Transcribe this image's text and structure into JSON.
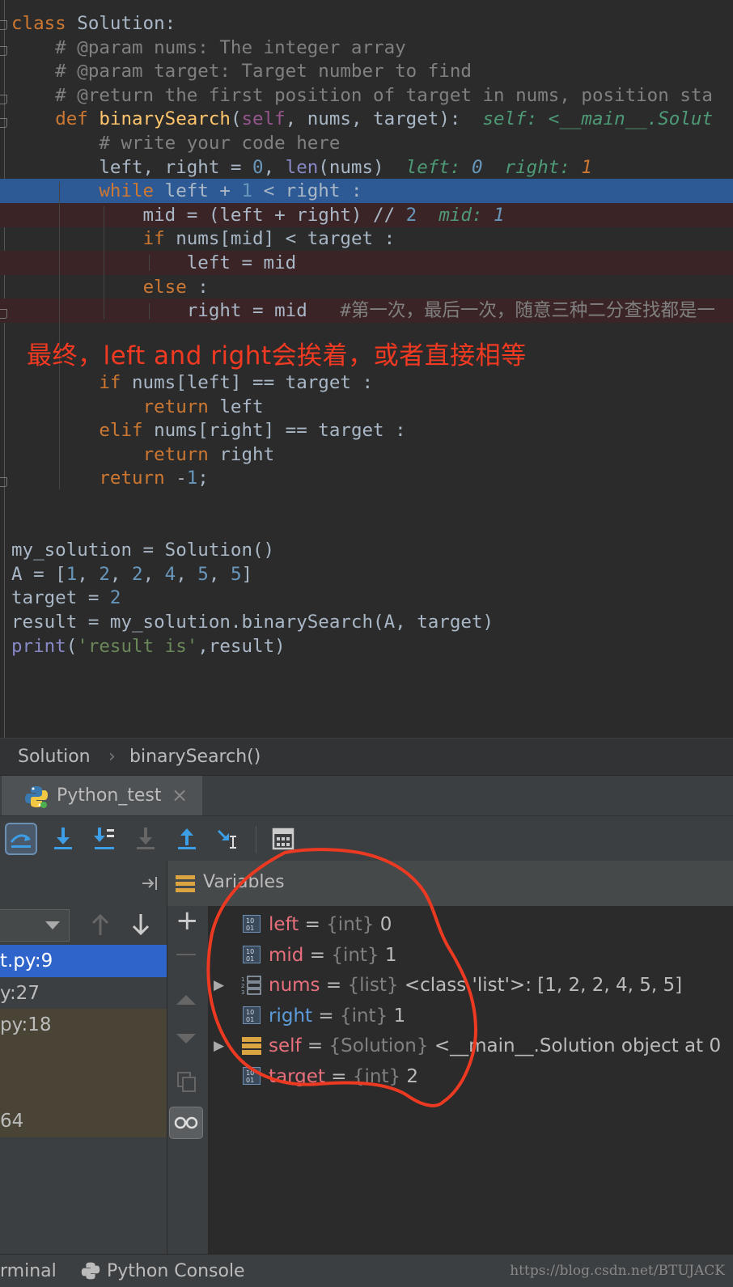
{
  "editor": {
    "lines": [
      [
        {
          "t": "class",
          "c": "kw"
        },
        {
          "t": " Solution:"
        }
      ],
      [
        {
          "t": "    # @param nums: The integer array",
          "c": "cm"
        }
      ],
      [
        {
          "t": "    # @param target: Target number to find",
          "c": "cm"
        }
      ],
      [
        {
          "t": "    # @return the first position of target in nums, position sta",
          "c": "cm"
        }
      ],
      [
        {
          "t": "    "
        },
        {
          "t": "def",
          "c": "kw"
        },
        {
          "t": " "
        },
        {
          "t": "binarySearch",
          "c": "fn"
        },
        {
          "t": "("
        },
        {
          "t": "self",
          "c": "sf"
        },
        {
          "t": ", nums, target):  "
        },
        {
          "t": "self: <__main__.Solut",
          "c": "hint"
        }
      ],
      [
        {
          "t": "        # write your code here",
          "c": "cm"
        }
      ],
      [
        {
          "t": "        left, right = "
        },
        {
          "t": "0",
          "c": "num"
        },
        {
          "t": ", "
        },
        {
          "t": "len",
          "c": "bi"
        },
        {
          "t": "(nums)  "
        },
        {
          "t": "left: ",
          "c": "hint"
        },
        {
          "t": "0",
          "c": "hintn"
        },
        {
          "t": "  right: ",
          "c": "hint"
        },
        {
          "t": "1",
          "c": "hintv"
        }
      ],
      [
        {
          "t": "        "
        },
        {
          "t": "while",
          "c": "kw"
        },
        {
          "t": " left + "
        },
        {
          "t": "1",
          "c": "num"
        },
        {
          "t": " < right :"
        }
      ],
      [
        {
          "t": "            mid = (left + right) // "
        },
        {
          "t": "2",
          "c": "num"
        },
        {
          "t": "  "
        },
        {
          "t": "mid: ",
          "c": "hint"
        },
        {
          "t": "1",
          "c": "hintn"
        }
      ],
      [
        {
          "t": "            "
        },
        {
          "t": "if",
          "c": "kw"
        },
        {
          "t": " nums[mid] < target :"
        }
      ],
      [
        {
          "t": "                left = mid"
        }
      ],
      [
        {
          "t": "            "
        },
        {
          "t": "else",
          "c": "kw"
        },
        {
          "t": " :"
        }
      ],
      [
        {
          "t": "                right = mid   "
        },
        {
          "t": "#第一次，最后一次，随意三种二分查找都是一",
          "c": "cm"
        }
      ],
      [
        {
          "t": ""
        }
      ],
      [
        {
          "t": ""
        }
      ],
      [
        {
          "t": "        "
        },
        {
          "t": "if",
          "c": "kw"
        },
        {
          "t": " nums[left] == target :"
        }
      ],
      [
        {
          "t": "            "
        },
        {
          "t": "return",
          "c": "kw"
        },
        {
          "t": " left"
        }
      ],
      [
        {
          "t": "        "
        },
        {
          "t": "elif",
          "c": "kw"
        },
        {
          "t": " nums[right] == target :"
        }
      ],
      [
        {
          "t": "            "
        },
        {
          "t": "return",
          "c": "kw"
        },
        {
          "t": " right"
        }
      ],
      [
        {
          "t": "        "
        },
        {
          "t": "return",
          "c": "kw"
        },
        {
          "t": " -"
        },
        {
          "t": "1",
          "c": "num"
        },
        {
          "t": ";"
        }
      ],
      [
        {
          "t": ""
        }
      ],
      [
        {
          "t": ""
        }
      ],
      [
        {
          "t": "my_solution = Solution()"
        }
      ],
      [
        {
          "t": "A = ["
        },
        {
          "t": "1",
          "c": "num"
        },
        {
          "t": ", "
        },
        {
          "t": "2",
          "c": "num"
        },
        {
          "t": ", "
        },
        {
          "t": "2",
          "c": "num"
        },
        {
          "t": ", "
        },
        {
          "t": "4",
          "c": "num"
        },
        {
          "t": ", "
        },
        {
          "t": "5",
          "c": "num"
        },
        {
          "t": ", "
        },
        {
          "t": "5",
          "c": "num"
        },
        {
          "t": "]"
        }
      ],
      [
        {
          "t": "target = "
        },
        {
          "t": "2",
          "c": "num"
        }
      ],
      [
        {
          "t": "result = my_solution.binarySearch(A, target)"
        }
      ],
      [
        {
          "t": "print",
          "c": "bi"
        },
        {
          "t": "("
        },
        {
          "t": "'result is'",
          "c": "st"
        },
        {
          "t": ",result)"
        }
      ]
    ],
    "exec_line": 7,
    "breakpoint_lines": [
      8,
      10,
      12
    ],
    "annotation": "最终，left and right会挨着，或者直接相等"
  },
  "breadcrumb": {
    "class_name": "Solution",
    "separator": "›",
    "method_name": "binarySearch()"
  },
  "debug": {
    "tab_label": "Python_test",
    "tab_close": "×",
    "variables_title": "Variables",
    "frames": [
      {
        "label": "t.py:9",
        "state": "selected"
      },
      {
        "label": "y:27",
        "state": "normal"
      },
      {
        "label": "py:18",
        "state": "library"
      },
      {
        "label": "",
        "state": "library"
      },
      {
        "label": "",
        "state": "library"
      },
      {
        "label": "64",
        "state": "library"
      }
    ],
    "variables": [
      {
        "name": "left",
        "type": "{int}",
        "value": "0",
        "expandable": false,
        "changed": false,
        "icon": "int"
      },
      {
        "name": "mid",
        "type": "{int}",
        "value": "1",
        "expandable": false,
        "changed": false,
        "icon": "int"
      },
      {
        "name": "nums",
        "type": "{list}",
        "value": "<class 'list'>: [1, 2, 2, 4, 5, 5]",
        "expandable": true,
        "changed": false,
        "icon": "list"
      },
      {
        "name": "right",
        "type": "{int}",
        "value": "1",
        "expandable": false,
        "changed": true,
        "icon": "int"
      },
      {
        "name": "self",
        "type": "{Solution}",
        "value": "<__main__.Solution object at 0",
        "expandable": true,
        "changed": false,
        "icon": "object"
      },
      {
        "name": "target",
        "type": "{int}",
        "value": "2",
        "expandable": false,
        "changed": false,
        "icon": "int"
      }
    ],
    "side_plus": "+",
    "side_minus": "—"
  },
  "bottom": {
    "terminal_label": "rminal",
    "console_label": "Python Console",
    "watermark": "https://blog.csdn.net/BTUJACK"
  },
  "colors": {
    "exec_line_bg": "#2d5a94",
    "breakpoint_bg": "#3b2425",
    "annotation": "#f23a22",
    "frame_selected": "#2f65ca"
  }
}
